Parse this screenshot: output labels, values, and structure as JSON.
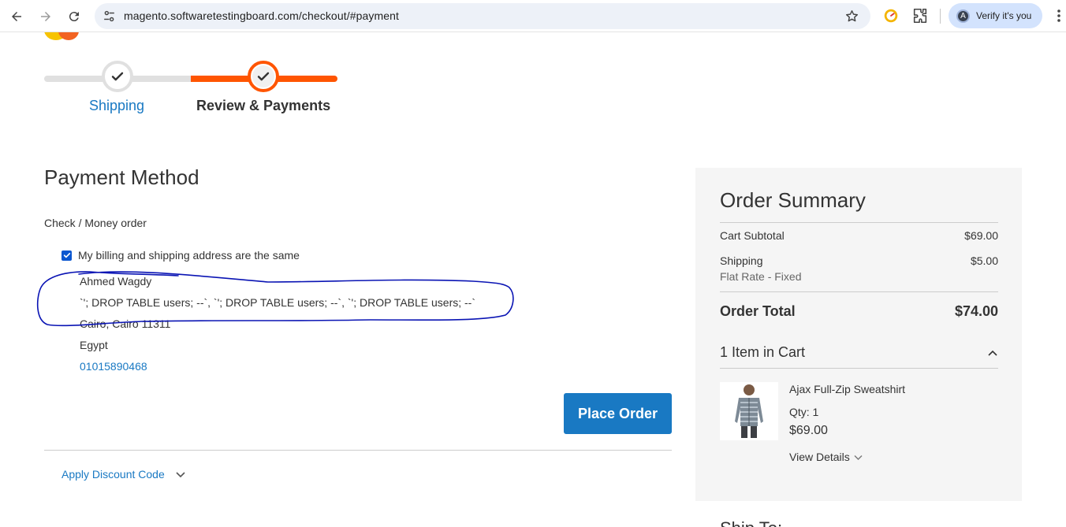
{
  "browser": {
    "url": "magento.softwaretestingboard.com/checkout/#payment",
    "profile_label": "Verify it's you",
    "profile_initial": "A"
  },
  "progress": {
    "steps": [
      {
        "label": "Shipping",
        "state": "complete"
      },
      {
        "label": "Review & Payments",
        "state": "current"
      }
    ],
    "active_color": "#ff5501"
  },
  "payment": {
    "title": "Payment Method",
    "method": "Check / Money order",
    "same_address_label": "My billing and shipping address are the same",
    "same_address_checked": true,
    "address": {
      "name": "Ahmed Wagdy",
      "street": "`'; DROP TABLE users; --`, `'; DROP TABLE users; --`, `'; DROP TABLE users; --`",
      "city": "Cairo, Cairo 11311",
      "country": "Egypt",
      "phone": "01015890468"
    },
    "place_order_label": "Place Order",
    "discount_label": "Apply Discount Code"
  },
  "summary": {
    "title": "Order Summary",
    "subtotal_label": "Cart Subtotal",
    "subtotal_value": "$69.00",
    "shipping_label": "Shipping",
    "shipping_value": "$5.00",
    "shipping_method": "Flat Rate - Fixed",
    "total_label": "Order Total",
    "total_value": "$74.00",
    "items_heading": "1 Item in Cart",
    "item": {
      "name": "Ajax Full-Zip Sweatshirt",
      "qty": "Qty: 1",
      "price": "$69.00",
      "details_label": "View Details"
    }
  },
  "colors": {
    "link": "#1979c3",
    "primary_button": "#1979c3",
    "annotation": "#0a14b4"
  }
}
